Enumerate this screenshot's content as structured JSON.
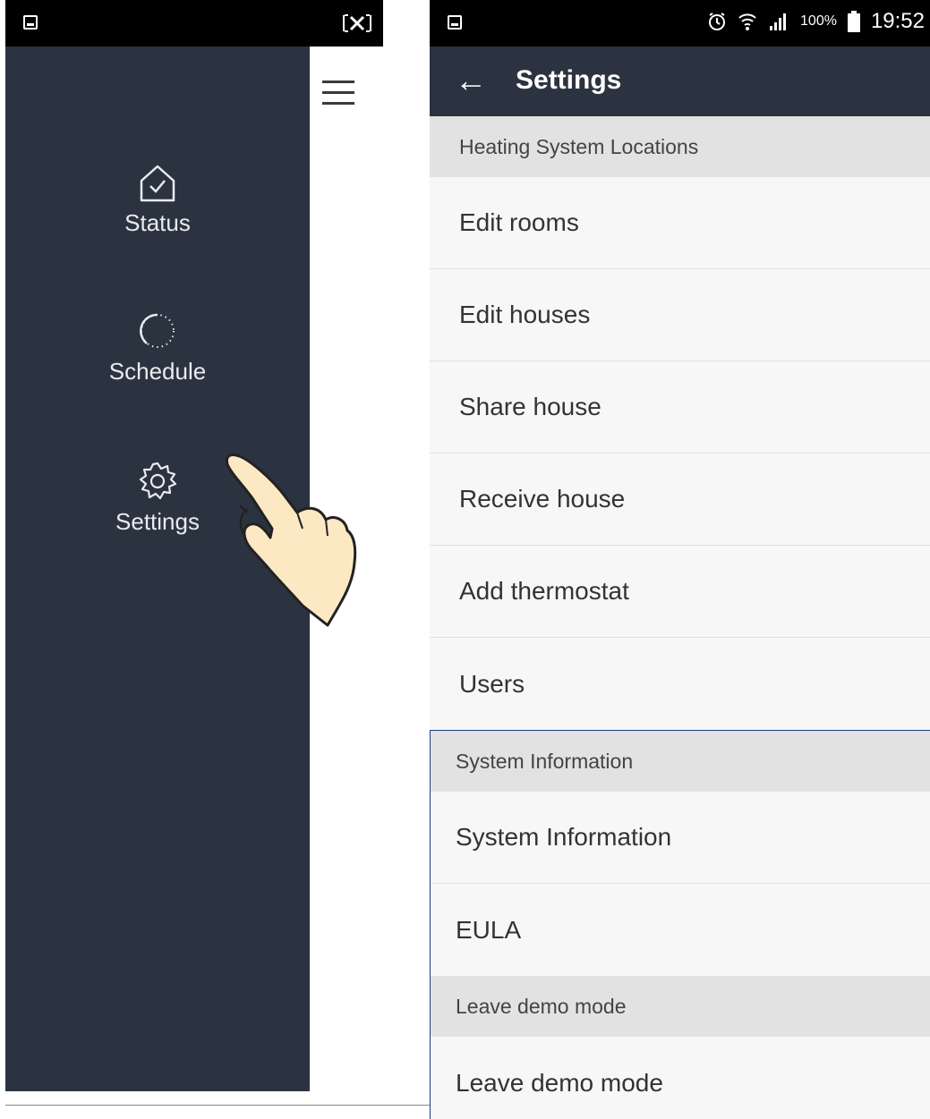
{
  "left_panel": {
    "nav_items": [
      {
        "label": "Status",
        "icon": "house-check-icon"
      },
      {
        "label": "Schedule",
        "icon": "dotted-circle-icon"
      },
      {
        "label": "Settings",
        "icon": "gear-icon"
      }
    ],
    "menu_icon": "hamburger-menu-icon"
  },
  "right_panel": {
    "status_bar": {
      "icons": [
        "alarm-icon",
        "wifi-icon",
        "signal-icon",
        "battery-icon"
      ],
      "battery": "100%",
      "time": "19:52"
    },
    "toolbar": {
      "back_icon": "←",
      "title": "Settings"
    },
    "sections": [
      {
        "header": "Heating System Locations",
        "items": [
          "Edit rooms",
          "Edit houses",
          "Share house",
          "Receive house",
          "Add thermostat",
          "Users"
        ]
      },
      {
        "header": "System Information",
        "items": [
          "System Information",
          "EULA"
        ]
      },
      {
        "header": "Leave demo mode",
        "items": [
          "Leave demo mode"
        ]
      }
    ]
  },
  "colors": {
    "drawer_bg": "#2b3340",
    "toolbar_bg": "#2b3340",
    "section_header_bg": "#e2e2e2",
    "list_bg": "#f7f7f7",
    "highlight_border": "#1d3f7a"
  }
}
